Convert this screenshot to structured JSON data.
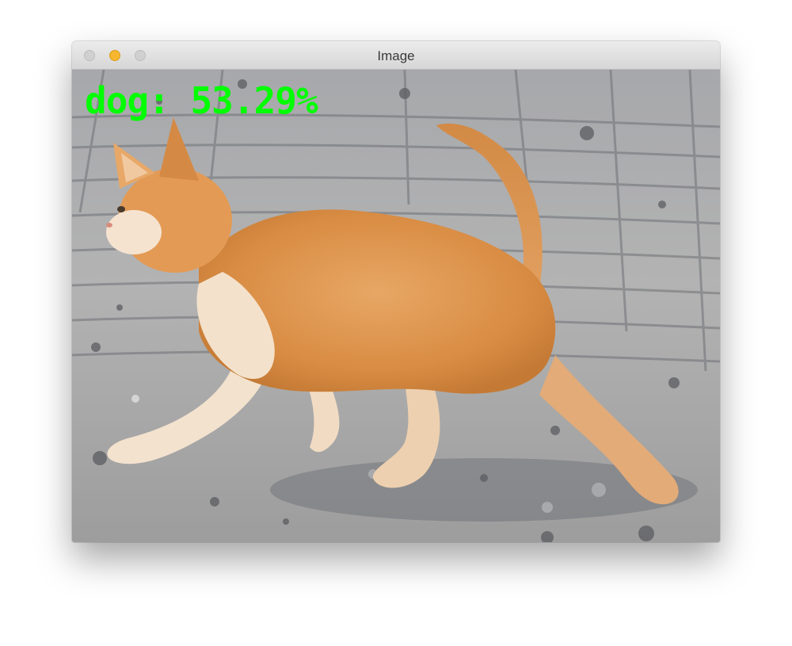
{
  "window": {
    "title": "Image"
  },
  "image": {
    "subject": "kitten",
    "overlay_label": "dog: 53.29%",
    "overlay_color": "#00ff00"
  }
}
